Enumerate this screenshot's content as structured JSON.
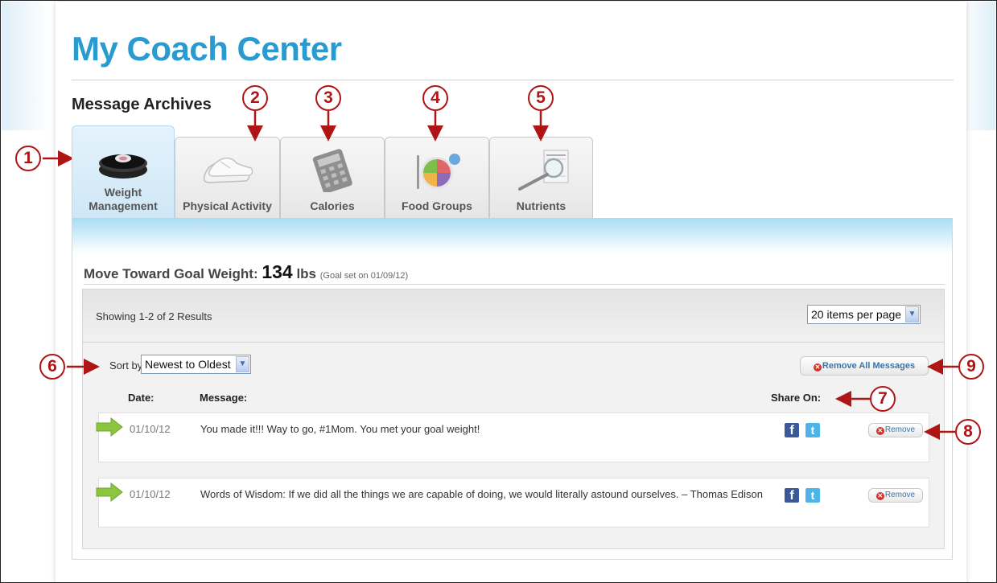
{
  "header": {
    "title": "My Coach Center",
    "subtitle": "Message Archives"
  },
  "tabs": [
    {
      "label": "Weight Management",
      "icon": "scale-icon",
      "active": true
    },
    {
      "label": "Physical Activity",
      "icon": "sneakers-icon",
      "active": false
    },
    {
      "label": "Calories",
      "icon": "calculator-icon",
      "active": false
    },
    {
      "label": "Food Groups",
      "icon": "plate-icon",
      "active": false
    },
    {
      "label": "Nutrients",
      "icon": "nutrition-label-icon",
      "active": false
    }
  ],
  "goal": {
    "prefix": "Move Toward Goal Weight:",
    "value": "134",
    "unit": "lbs",
    "note": "(Goal set on 01/09/12)"
  },
  "results": {
    "showing": "Showing 1-2 of 2 Results",
    "per_page": "20 items per page"
  },
  "sort": {
    "label": "Sort by:",
    "value": "Newest to Oldest"
  },
  "remove_all_label": "Remove All Messages",
  "columns": {
    "date": "Date:",
    "message": "Message:",
    "share": "Share On:"
  },
  "messages": [
    {
      "date": "01/10/12",
      "text": "You made it!!! Way to go, #1Mom. You met your goal weight!",
      "remove_label": "Remove"
    },
    {
      "date": "01/10/12",
      "text": "Words of Wisdom: If we did all the things we are capable of doing, we would literally astound ourselves. – Thomas Edison",
      "remove_label": "Remove"
    }
  ],
  "callouts": [
    "1",
    "2",
    "3",
    "4",
    "5",
    "6",
    "7",
    "8",
    "9"
  ],
  "colors": {
    "title": "#2a9bd0",
    "callout": "#b01515",
    "facebook": "#3b5998",
    "twitter": "#4cb4e6",
    "arrow": "#8cc63f"
  }
}
